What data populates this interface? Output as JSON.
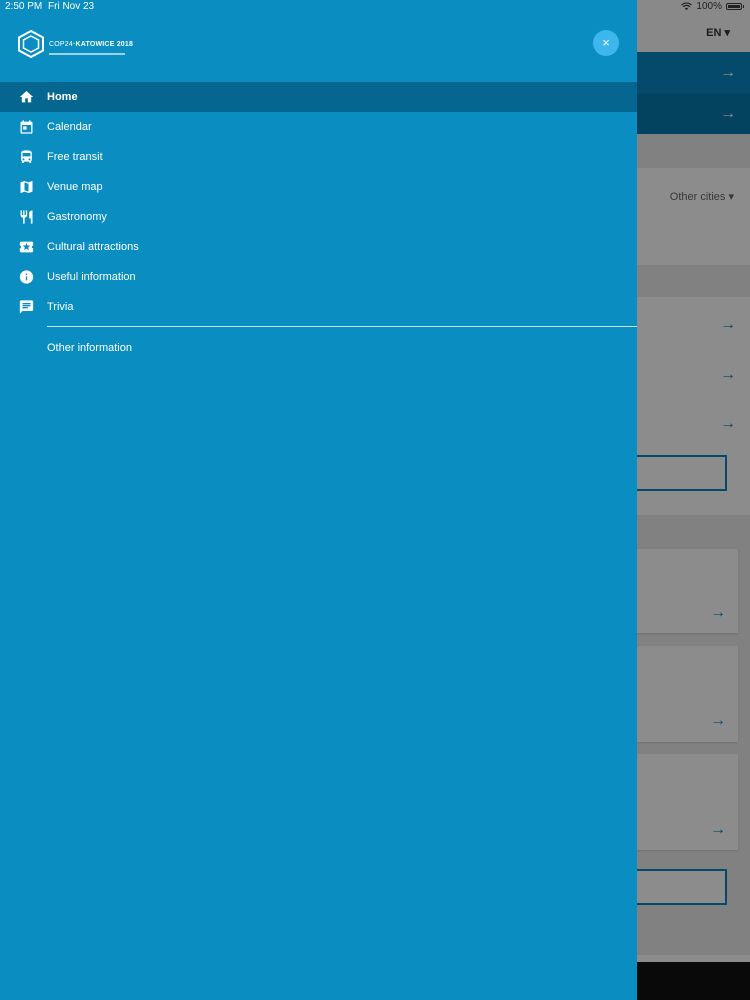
{
  "status_bar": {
    "time": "2:50 PM",
    "date": "Fri Nov 23",
    "battery": "100%"
  },
  "background": {
    "language": "EN ▾",
    "other_cities": "Other cities ▾",
    "arrow": "→"
  },
  "drawer": {
    "logo_text_a": "COP24",
    "logo_text_b": "·KATOWICE 2018",
    "close_glyph": "×",
    "items": [
      {
        "label": "Home",
        "icon": "home-icon"
      },
      {
        "label": "Calendar",
        "icon": "calendar-icon"
      },
      {
        "label": "Free transit",
        "icon": "bus-icon"
      },
      {
        "label": "Venue map",
        "icon": "map-icon"
      },
      {
        "label": "Gastronomy",
        "icon": "restaurant-icon"
      },
      {
        "label": "Cultural attractions",
        "icon": "ticket-icon"
      },
      {
        "label": "Useful information",
        "icon": "info-icon"
      },
      {
        "label": "Trivia",
        "icon": "chat-icon"
      }
    ],
    "other_information": "Other information"
  },
  "colors": {
    "drawer": "#0a8ec2",
    "active_item": "#05668f",
    "close_button": "#3db6ec"
  }
}
